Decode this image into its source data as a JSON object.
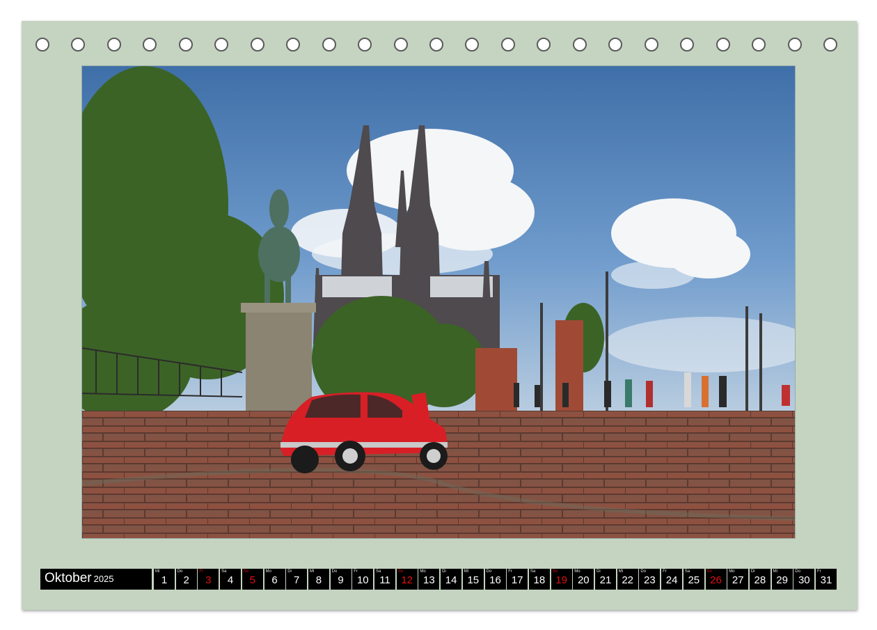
{
  "binding": {
    "hole_count": 23
  },
  "photo": {
    "subject": "",
    "colors": {
      "sky": "#4d7fb8",
      "car": "#d81f26",
      "pavement": "#8a5040",
      "foliage": "#3d6a2a"
    }
  },
  "calendar": {
    "month": "Oktober",
    "year": "2025",
    "days": [
      {
        "abbr": "Mi",
        "num": "1",
        "holiday": false
      },
      {
        "abbr": "Do",
        "num": "2",
        "holiday": false
      },
      {
        "abbr": "Fr",
        "num": "3",
        "holiday": true
      },
      {
        "abbr": "Sa",
        "num": "4",
        "holiday": false
      },
      {
        "abbr": "So",
        "num": "5",
        "holiday": true
      },
      {
        "abbr": "Mo",
        "num": "6",
        "holiday": false
      },
      {
        "abbr": "Di",
        "num": "7",
        "holiday": false
      },
      {
        "abbr": "Mi",
        "num": "8",
        "holiday": false
      },
      {
        "abbr": "Do",
        "num": "9",
        "holiday": false
      },
      {
        "abbr": "Fr",
        "num": "10",
        "holiday": false
      },
      {
        "abbr": "Sa",
        "num": "11",
        "holiday": false
      },
      {
        "abbr": "So",
        "num": "12",
        "holiday": true
      },
      {
        "abbr": "Mo",
        "num": "13",
        "holiday": false
      },
      {
        "abbr": "Di",
        "num": "14",
        "holiday": false
      },
      {
        "abbr": "Mi",
        "num": "15",
        "holiday": false
      },
      {
        "abbr": "Do",
        "num": "16",
        "holiday": false
      },
      {
        "abbr": "Fr",
        "num": "17",
        "holiday": false
      },
      {
        "abbr": "Sa",
        "num": "18",
        "holiday": false
      },
      {
        "abbr": "So",
        "num": "19",
        "holiday": true
      },
      {
        "abbr": "Mo",
        "num": "20",
        "holiday": false
      },
      {
        "abbr": "Di",
        "num": "21",
        "holiday": false
      },
      {
        "abbr": "Mi",
        "num": "22",
        "holiday": false
      },
      {
        "abbr": "Do",
        "num": "23",
        "holiday": false
      },
      {
        "abbr": "Fr",
        "num": "24",
        "holiday": false
      },
      {
        "abbr": "Sa",
        "num": "25",
        "holiday": false
      },
      {
        "abbr": "So",
        "num": "26",
        "holiday": true
      },
      {
        "abbr": "Mo",
        "num": "27",
        "holiday": false
      },
      {
        "abbr": "Di",
        "num": "28",
        "holiday": false
      },
      {
        "abbr": "Mi",
        "num": "29",
        "holiday": false
      },
      {
        "abbr": "Do",
        "num": "30",
        "holiday": false
      },
      {
        "abbr": "Fr",
        "num": "31",
        "holiday": false
      }
    ]
  }
}
